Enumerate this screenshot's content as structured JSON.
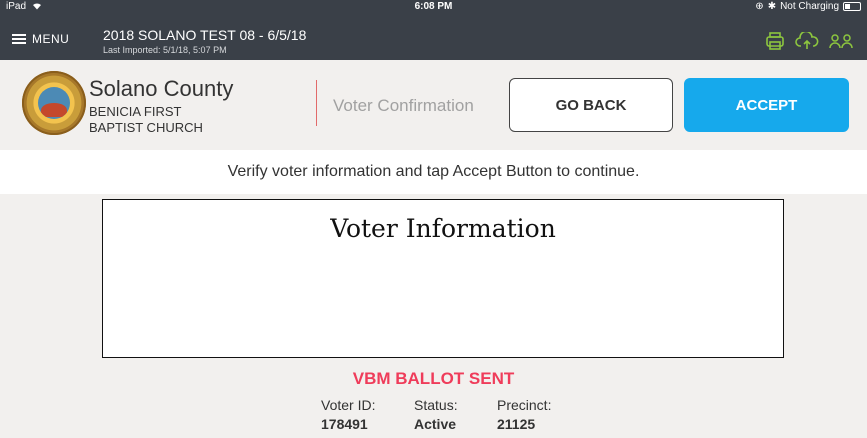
{
  "status_bar": {
    "device": "iPad",
    "time": "6:08 PM",
    "charging": "Not Charging"
  },
  "top_bar": {
    "menu_label": "MENU",
    "title": "2018 SOLANO TEST 08 - 6/5/18",
    "subtitle": "Last Imported: 5/1/18, 5:07 PM",
    "icons": [
      "printer-icon",
      "cloud-upload-icon",
      "users-icon"
    ],
    "icon_color": "#8dc63f"
  },
  "header": {
    "county": "Solano County",
    "site_line1": "BENICIA FIRST",
    "site_line2": "BAPTIST CHURCH",
    "page_name": "Voter Confirmation",
    "go_back_label": "GO BACK",
    "accept_label": "ACCEPT",
    "accent_color": "#16a9ec"
  },
  "instruction": "Verify voter information and tap Accept Button to continue.",
  "voter_info": {
    "title": "Voter Information",
    "status_banner": "VBM BALLOT SENT",
    "fields": [
      {
        "label": "Voter ID:",
        "value": "178491"
      },
      {
        "label": "Status:",
        "value": "Active"
      },
      {
        "label": "Precinct:",
        "value": "21125"
      }
    ]
  }
}
